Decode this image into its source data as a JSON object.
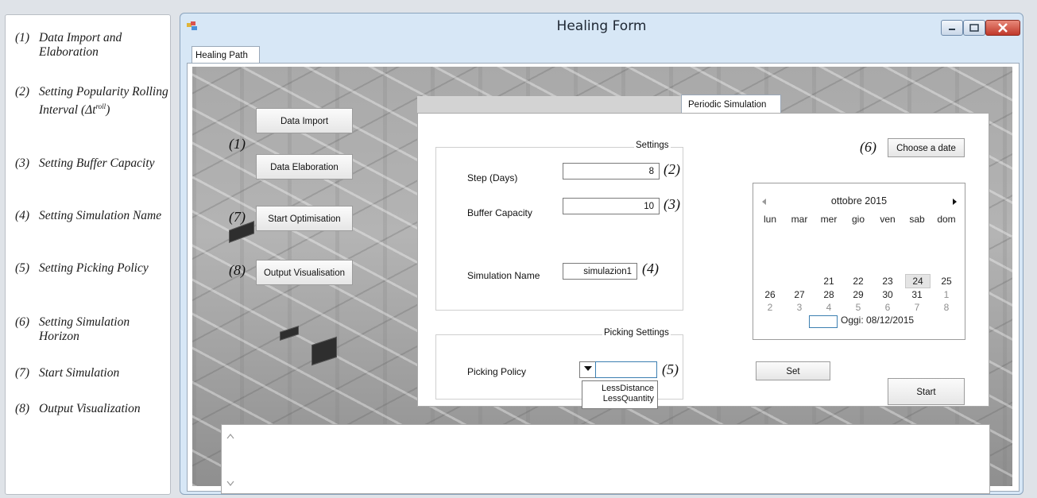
{
  "legend": [
    {
      "num": "(1)",
      "text": "Data Import and Elaboration"
    },
    {
      "num": "(2)",
      "text": "Setting Popularity Rolling Interval (Δt"
    },
    {
      "num": "(3)",
      "text": "Setting Buffer Capacity"
    },
    {
      "num": "(4)",
      "text": "Setting Simulation Name"
    },
    {
      "num": "(5)",
      "text": "Setting Picking Policy"
    },
    {
      "num": "(6)",
      "text": "Setting Simulation Horizon"
    },
    {
      "num": "(7)",
      "text": "Start Simulation"
    },
    {
      "num": "(8)",
      "text": "Output Visualization"
    }
  ],
  "legend_superscript": "roll",
  "legend_close": ")",
  "window": {
    "title": "Healing Form",
    "tab": "Healing Path"
  },
  "actions": {
    "data_import": "Data Import",
    "data_elaboration": "Data Elaboration",
    "start_optimisation": "Start Optimisation",
    "output_visualisation": "Output Visualisation"
  },
  "markers": {
    "m1": "(1)",
    "m7": "(7)",
    "m8": "(8)",
    "m2": "(2)",
    "m3": "(3)",
    "m4": "(4)",
    "m5": "(5)",
    "m6": "(6)"
  },
  "periodic": {
    "tab": "Periodic Simulation",
    "settings_title": "Settings",
    "step_label": "Step (Days)",
    "step_value": "8",
    "buffer_label": "Buffer Capacity",
    "buffer_value": "10",
    "simname_label": "Simulation Name",
    "simname_value": "simulazion1",
    "picking_title": "Picking Settings",
    "picking_label": "Picking Policy",
    "picking_options": [
      "LessDistance",
      "LessQuantity"
    ],
    "choose_date": "Choose a date",
    "set": "Set",
    "start": "Start"
  },
  "calendar": {
    "month": "ottobre 2015",
    "weekdays": [
      "lun",
      "mar",
      "mer",
      "gio",
      "ven",
      "sab",
      "dom"
    ],
    "week4": [
      "21",
      "22",
      "23",
      "24",
      "25"
    ],
    "week5": [
      "26",
      "27",
      "28",
      "29",
      "30",
      "31",
      "1"
    ],
    "week6": [
      "2",
      "3",
      "4",
      "5",
      "6",
      "7",
      "8"
    ],
    "today": "Oggi: 08/12/2015",
    "selected": "24"
  },
  "icons": [
    "prev-month-icon",
    "next-month-icon",
    "combo-arrow-icon",
    "app-icon",
    "minimize-icon",
    "maximize-icon",
    "close-icon"
  ]
}
